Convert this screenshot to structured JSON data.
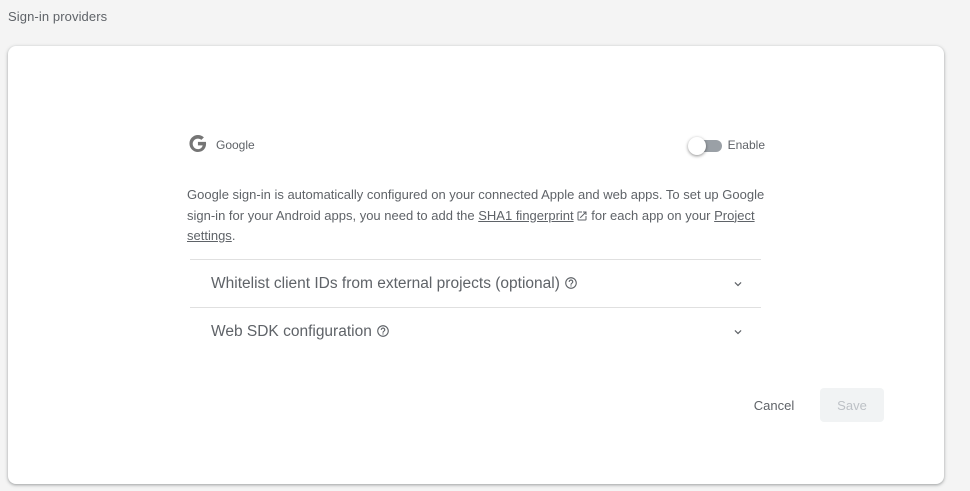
{
  "section": {
    "title": "Sign-in providers"
  },
  "provider": {
    "name": "Google",
    "icon": "google-g-icon",
    "toggle_label": "Enable",
    "enabled": false
  },
  "description": {
    "part1": "Google sign-in is automatically configured on your connected Apple and web apps. To set up Google sign-in for your Android apps, you need to add the ",
    "sha1_link": "SHA1 fingerprint",
    "part2": " for each app on your ",
    "project_link": "Project settings",
    "part3": "."
  },
  "expanders": [
    {
      "label": "Whitelist client IDs from external projects (optional)"
    },
    {
      "label": "Web SDK configuration"
    }
  ],
  "actions": {
    "cancel_label": "Cancel",
    "save_label": "Save"
  },
  "colors": {
    "text": "#5f6368",
    "divider": "#e0e0e0",
    "disabled_bg": "#f1f3f4"
  }
}
